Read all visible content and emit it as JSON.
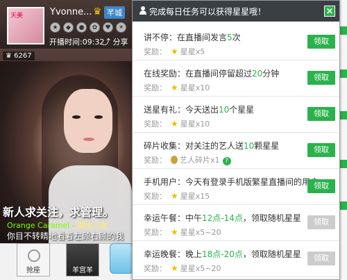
{
  "anchor": {
    "name": "Yvonne...",
    "badge": "芊城",
    "start_time": "开播时间:09:32",
    "share": "分享",
    "fans": "6267",
    "avatar_tag": "天美"
  },
  "chat": {
    "line1": "新人求关注，求管理。",
    "line2_name": "Orange Caramel - ",
    "line2_song": "魔法少女",
    "line3": "你目不转睛地看着左顾右顾的我"
  },
  "bottom": {
    "seat_label": "抢座",
    "seat2_label": "羊宫羊"
  },
  "panel": {
    "title": "完成每日任务可以获得星星哦！",
    "close": "×",
    "reward_label": "奖励：",
    "tasks": [
      {
        "pre": "讲不停：在直播间发言",
        "num": "5",
        "post": "次",
        "reward_icon": "star-icon",
        "reward_name": "星星",
        "reward_val": "x5",
        "button": "领取",
        "enabled": true
      },
      {
        "pre": "在线奖励：在直播间停留超过",
        "num": "20",
        "post": "分钟",
        "reward_icon": "star-icon",
        "reward_name": "星星",
        "reward_val": "x10",
        "button": "领取",
        "enabled": true
      },
      {
        "pre": "送星有礼：今天送出",
        "num": "10",
        "post": "个星星",
        "reward_icon": "star-icon",
        "reward_name": "星星",
        "reward_val": "x10",
        "button": "领取",
        "enabled": true
      },
      {
        "pre": "碎片收集：对关注的艺人送",
        "num": "10",
        "post": "颗星星",
        "reward_icon": "fragment-icon",
        "reward_name": "艺人碎片",
        "reward_val": "x1",
        "button": "领取",
        "enabled": true
      },
      {
        "pre": "手机用户：今天有登录手机版繁星直播间的用户",
        "num": "",
        "post": "",
        "reward_icon": "star-icon",
        "reward_name": "星星",
        "reward_val": "x15",
        "button": "领取",
        "enabled": true
      },
      {
        "pre": "幸运午餐：中午",
        "num": "12点-14点",
        "post": "，领取随机星星",
        "reward_icon": "star-icon",
        "reward_name": "星星",
        "reward_val": "x5~20",
        "button": "领取",
        "enabled": false
      },
      {
        "pre": "幸运晚餐：晚上",
        "num": "18点-20点",
        "post": "，领取随机星星",
        "reward_icon": "star-icon",
        "reward_name": "星星",
        "reward_val": "x5~20",
        "button": "领取",
        "enabled": false
      }
    ]
  },
  "colors": {
    "accent": "#2bb24c",
    "header": "#3a3f44",
    "disabled": "#cccccc"
  }
}
